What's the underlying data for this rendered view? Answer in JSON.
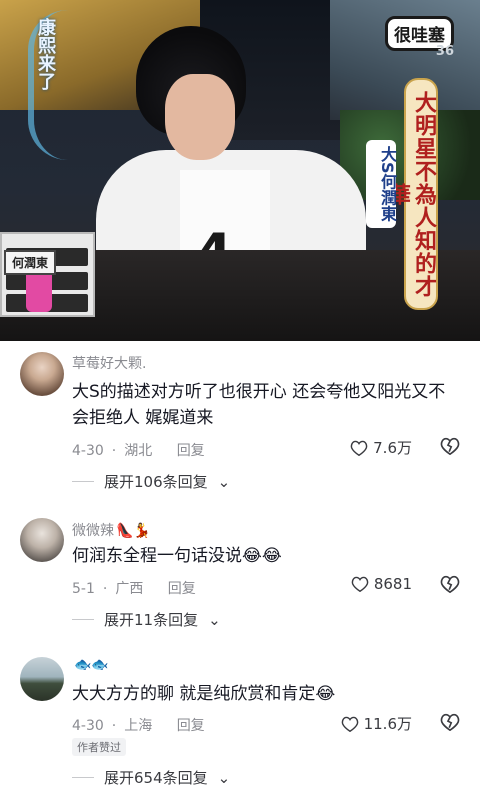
{
  "video": {
    "logo_text": "康熙来了",
    "badge_text": "很哇塞",
    "badge_number": "36",
    "side_title": "大明星不為人知的才華",
    "side_sub": "大S何潤東",
    "host_tag": "何潤東",
    "shirt_mark": "4"
  },
  "comments": [
    {
      "username": "草莓好大颗.",
      "username_emoji": "",
      "text": "大S的描述对方听了也很开心 还会夸他又阳光又不会拒绝人 娓娓道来",
      "date": "4-30",
      "location": "湖北",
      "reply_label": "回复",
      "likes": "7.6万",
      "expand_label": "展开106条回复",
      "author_tag": ""
    },
    {
      "username": "微微辣",
      "username_emoji": "👠💃",
      "text": "何润东全程一句话没说😂😂",
      "date": "5-1",
      "location": "广西",
      "reply_label": "回复",
      "likes": "8681",
      "expand_label": "展开11条回复",
      "author_tag": ""
    },
    {
      "username": "",
      "username_emoji": "🐟🐟",
      "text": "大大方方的聊 就是纯欣赏和肯定😂",
      "date": "4-30",
      "location": "上海",
      "reply_label": "回复",
      "likes": "11.6万",
      "expand_label": "展开654条回复",
      "author_tag": "作者赞过"
    }
  ]
}
